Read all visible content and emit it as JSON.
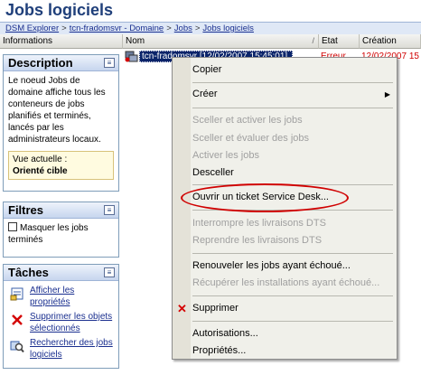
{
  "page": {
    "title": "Jobs logiciels"
  },
  "breadcrumb": [
    "DSM Explorer",
    "tcn-fradomsvr - Domaine",
    "Jobs",
    "Jobs logiciels"
  ],
  "columns": {
    "informations": "Informations",
    "nom": "Nom",
    "sort_indicator": "/",
    "etat": "Etat",
    "creation": "Création"
  },
  "description_panel": {
    "title": "Description",
    "text": "Le noeud Jobs de domaine affiche tous les conteneurs de jobs planifiés et terminés, lancés par les administrateurs locaux.",
    "current_view_label": "Vue actuelle :",
    "current_view_value": "Orienté cible"
  },
  "filters_panel": {
    "title": "Filtres",
    "hide_jobs_label": "Masquer les jobs terminés"
  },
  "tasks_panel": {
    "title": "Tâches",
    "tasks": [
      {
        "label": "Afficher les propriétés",
        "icon": "properties-icon"
      },
      {
        "label": "Supprimer les objets sélectionnés",
        "icon": "delete-icon"
      },
      {
        "label": "Rechercher des jobs logiciels",
        "icon": "search-icon"
      }
    ]
  },
  "job_row": {
    "name": "tcn-fradomsvr [12/02/2007 15:45:01]",
    "state": "Erreur",
    "created": "12/02/2007 15"
  },
  "context_menu": {
    "items": [
      {
        "label": "Copier",
        "enabled": true
      },
      {
        "label": "Créer",
        "enabled": true,
        "submenu": true
      },
      {
        "label": "Sceller et activer les jobs",
        "enabled": false
      },
      {
        "label": "Sceller et évaluer des jobs",
        "enabled": false
      },
      {
        "label": "Activer les jobs",
        "enabled": false
      },
      {
        "label": "Desceller",
        "enabled": true
      },
      {
        "label": "Ouvrir un ticket Service Desk...",
        "enabled": true
      },
      {
        "label": "Interrompre les livraisons DTS",
        "enabled": false
      },
      {
        "label": "Reprendre les livraisons DTS",
        "enabled": false
      },
      {
        "label": "Renouveler les jobs ayant échoué...",
        "enabled": true
      },
      {
        "label": "Récupérer les installations ayant échoué...",
        "enabled": false
      },
      {
        "label": "Supprimer",
        "enabled": true,
        "icon": "delete-icon"
      },
      {
        "label": "Autorisations...",
        "enabled": true
      },
      {
        "label": "Propriétés...",
        "enabled": true
      }
    ]
  },
  "colors": {
    "title_blue": "#1f3f7a",
    "error_red": "#d00000",
    "selection_blue": "#0a246a"
  }
}
